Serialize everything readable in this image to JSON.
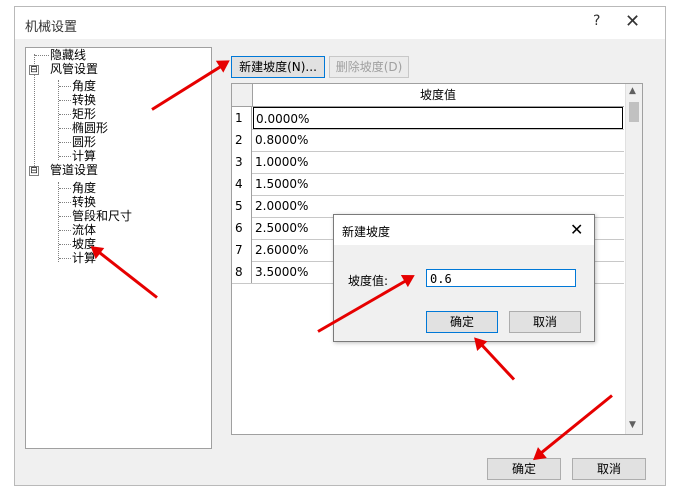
{
  "window": {
    "title": "机械设置",
    "help_glyph": "?",
    "close_glyph": "✕"
  },
  "tree": {
    "items": [
      {
        "label": "隐藏线",
        "level": 1
      },
      {
        "label": "风管设置",
        "level": 0,
        "expander": "⊟"
      },
      {
        "label": "角度",
        "level": 2
      },
      {
        "label": "转换",
        "level": 2
      },
      {
        "label": "矩形",
        "level": 2
      },
      {
        "label": "椭圆形",
        "level": 2
      },
      {
        "label": "圆形",
        "level": 2
      },
      {
        "label": "计算",
        "level": 2
      },
      {
        "label": "管道设置",
        "level": 0,
        "expander": "⊟"
      },
      {
        "label": "角度",
        "level": 2
      },
      {
        "label": "转换",
        "level": 2
      },
      {
        "label": "管段和尺寸",
        "level": 2
      },
      {
        "label": "流体",
        "level": 2
      },
      {
        "label": "坡度",
        "level": 2
      },
      {
        "label": "计算",
        "level": 2
      }
    ]
  },
  "toolbar": {
    "new_slope": "新建坡度(N)...",
    "delete_slope": "删除坡度(D)"
  },
  "grid": {
    "column": "坡度值",
    "rows": [
      {
        "index": "1",
        "value": "0.0000%"
      },
      {
        "index": "2",
        "value": "0.8000%"
      },
      {
        "index": "3",
        "value": "1.0000%"
      },
      {
        "index": "4",
        "value": "1.5000%"
      },
      {
        "index": "5",
        "value": "2.0000%"
      },
      {
        "index": "6",
        "value": "2.5000%"
      },
      {
        "index": "7",
        "value": "2.6000%"
      },
      {
        "index": "8",
        "value": "3.5000%"
      }
    ]
  },
  "dialog": {
    "title": "新建坡度",
    "label": "坡度值:",
    "value": "0.6",
    "ok": "确定",
    "cancel": "取消",
    "close_glyph": "✕"
  },
  "footer": {
    "ok": "确定",
    "cancel": "取消"
  },
  "annotation_color": "#e60000"
}
